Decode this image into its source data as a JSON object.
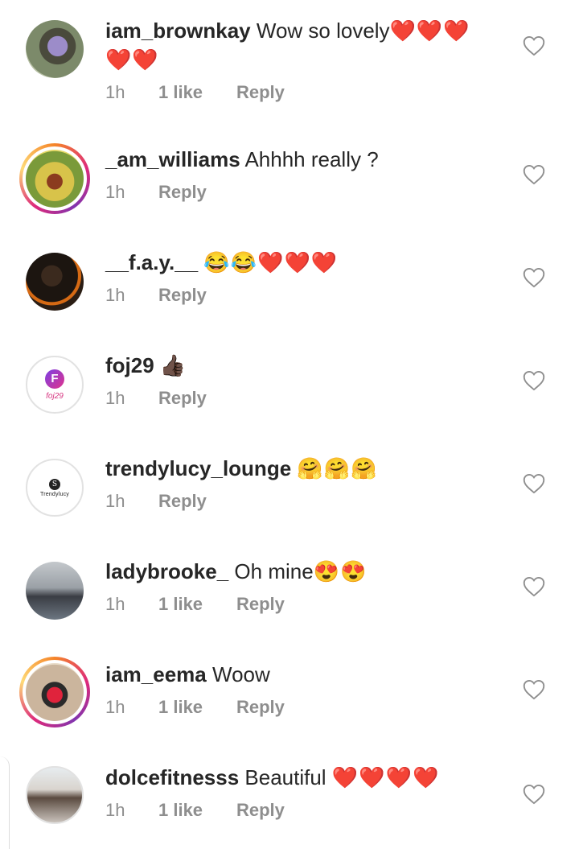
{
  "comments": [
    {
      "username": "iam_brownkay",
      "text": "Wow so lovely",
      "emoji": "❤️❤️❤️",
      "emoji_line2": "❤️❤️",
      "time": "1h",
      "likes": "1 like",
      "reply": "Reply",
      "story_ring": false
    },
    {
      "username": "_am_williams",
      "text": "Ahhhh really ?",
      "emoji": "",
      "time": "1h",
      "likes": "",
      "reply": "Reply",
      "story_ring": true
    },
    {
      "username": "__f.a.y.__",
      "text": "",
      "emoji": "😂😂❤️❤️❤️",
      "time": "1h",
      "likes": "",
      "reply": "Reply",
      "story_ring": false
    },
    {
      "username": "foj29",
      "text": "",
      "emoji": "👍🏿",
      "time": "1h",
      "likes": "",
      "reply": "Reply",
      "story_ring": false,
      "avatar_logo_letter": "F",
      "avatar_logo_text": "foj29"
    },
    {
      "username": "trendylucy_lounge",
      "text": "",
      "emoji": "🤗🤗🤗",
      "time": "1h",
      "likes": "",
      "reply": "Reply",
      "story_ring": false,
      "avatar_logo_letter": "S",
      "avatar_logo_text": "Trendylucy"
    },
    {
      "username": "ladybrooke_",
      "text": "Oh mine",
      "emoji": "😍😍",
      "time": "1h",
      "likes": "1 like",
      "reply": "Reply",
      "story_ring": false
    },
    {
      "username": "iam_eema",
      "text": "Woow",
      "emoji": "",
      "time": "1h",
      "likes": "1 like",
      "reply": "Reply",
      "story_ring": true
    },
    {
      "username": "dolcefitnesss",
      "text": "Beautiful",
      "emoji": "❤️❤️❤️❤️",
      "time": "1h",
      "likes": "1 like",
      "reply": "Reply",
      "story_ring": false
    }
  ],
  "icons": {
    "like": "heart-outline-icon"
  },
  "colors": {
    "text": "#262626",
    "meta": "#8e8e8e",
    "heart": "#e0162b"
  }
}
